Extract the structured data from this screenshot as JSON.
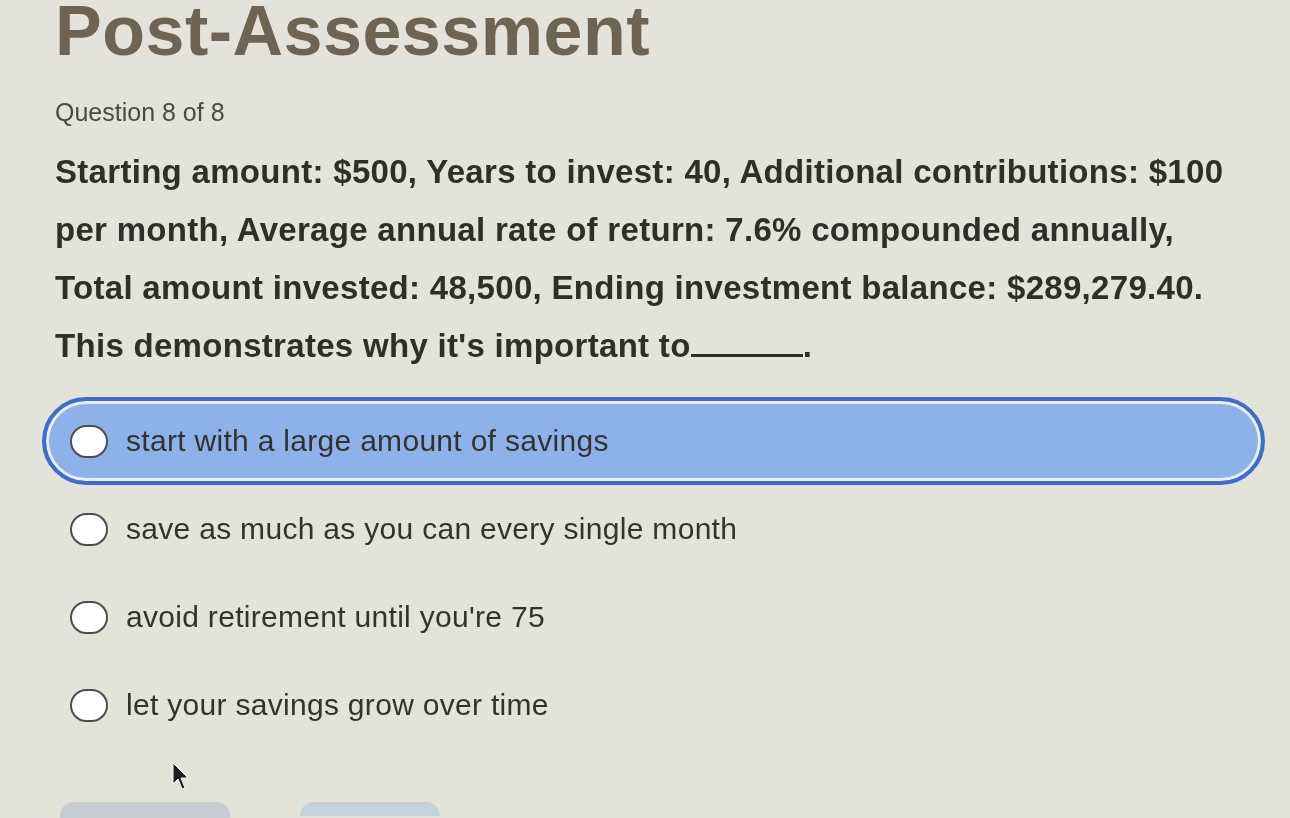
{
  "page": {
    "title": "Post-Assessment"
  },
  "question": {
    "counter": "Question 8 of 8",
    "prompt": "Starting amount: $500, Years to invest: 40, Additional contributions: $100 per month, Average annual rate of return: 7.6% compounded annually, Total amount invested: 48,500, Ending investment balance: $289,279.40.",
    "stem": "This demonstrates why it's important to",
    "stem_end": "."
  },
  "options": [
    {
      "label": "start with a large amount of savings",
      "highlighted": true,
      "selected": false
    },
    {
      "label": "save as much as you can every single month",
      "highlighted": false,
      "selected": false
    },
    {
      "label": "avoid retirement until you're 75",
      "highlighted": false,
      "selected": false
    },
    {
      "label": "let your savings grow over time",
      "highlighted": false,
      "selected": false
    }
  ]
}
